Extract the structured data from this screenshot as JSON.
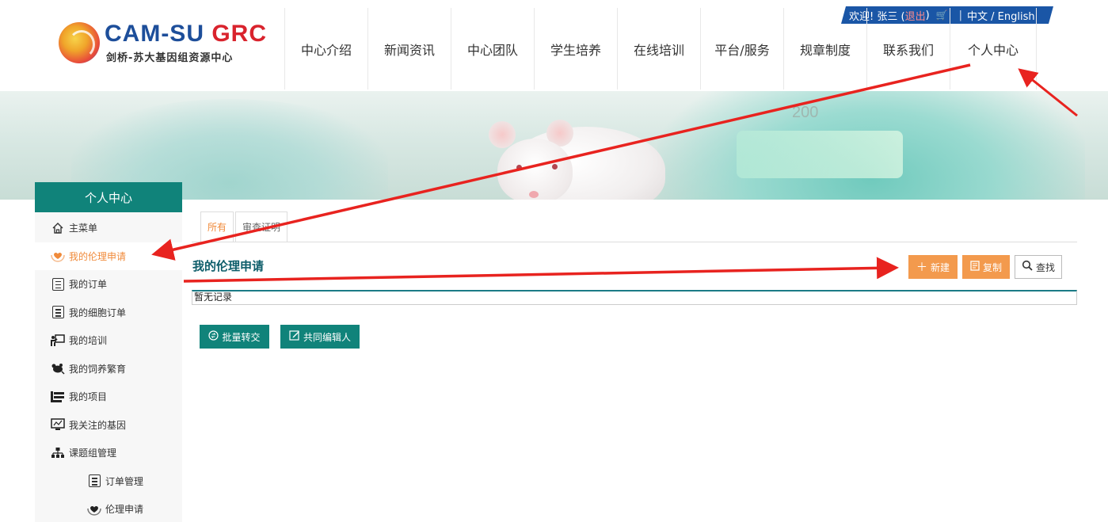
{
  "logo": {
    "cam": "CAM-SU",
    "grc": "GRC",
    "subtitle": "剑桥-苏大基因组资源中心"
  },
  "topbar": {
    "welcome": "欢迎! 张三 (",
    "logout": "退出",
    "close_paren": ")",
    "cart_icon": "cart-icon",
    "separator": "|",
    "language": "中文 / English"
  },
  "nav": {
    "items": [
      {
        "label": "中心介绍"
      },
      {
        "label": "新闻资讯"
      },
      {
        "label": "中心团队"
      },
      {
        "label": "学生培养"
      },
      {
        "label": "在线培训"
      },
      {
        "label": "平台/服务"
      },
      {
        "label": "规章制度"
      },
      {
        "label": "联系我们"
      },
      {
        "label": "个人中心"
      }
    ]
  },
  "banner": {
    "scale_number": "200"
  },
  "sidebar": {
    "title": "个人中心",
    "items": [
      {
        "label": "主菜单",
        "icon": "home-icon"
      },
      {
        "label": "我的伦理申请",
        "icon": "heart-hand-icon"
      },
      {
        "label": "我的订单",
        "icon": "list-icon"
      },
      {
        "label": "我的细胞订单",
        "icon": "list-icon"
      },
      {
        "label": "我的培训",
        "icon": "training-icon"
      },
      {
        "label": "我的饲养繁育",
        "icon": "breeding-icon"
      },
      {
        "label": "我的项目",
        "icon": "project-icon"
      },
      {
        "label": "我关注的基因",
        "icon": "monitor-icon"
      },
      {
        "label": "课题组管理",
        "icon": "org-chart-icon"
      },
      {
        "label": "订单管理",
        "icon": "list-icon"
      },
      {
        "label": "伦理申请",
        "icon": "heart-hand-icon"
      }
    ]
  },
  "tabs": [
    {
      "label": "所有"
    },
    {
      "label": "审查证明"
    }
  ],
  "section": {
    "title": "我的伦理申请",
    "new_button": "新建",
    "copy_button": "复制",
    "find_button": "查找",
    "empty_text": "暂无记录",
    "batch_button": "批量转交",
    "coedit_button": "共同编辑人"
  },
  "colors": {
    "teal": "#10837a",
    "orange": "#f39a4d",
    "blue": "#1a56a6",
    "arrow_red": "#e8231f"
  }
}
